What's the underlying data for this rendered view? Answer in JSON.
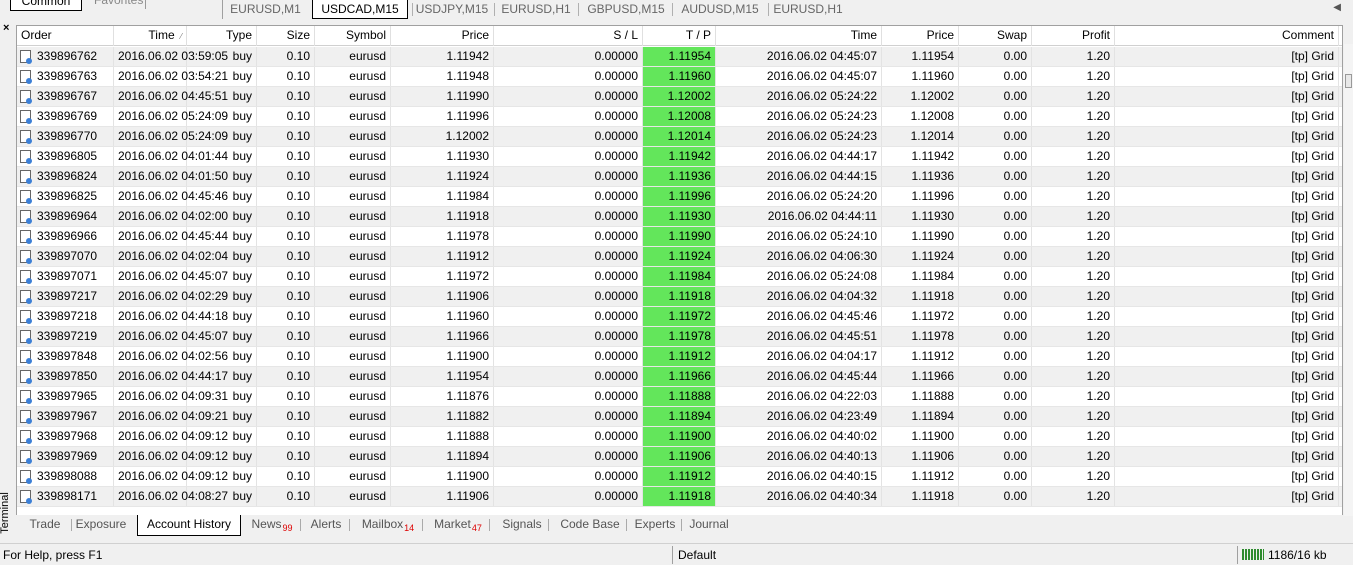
{
  "nav_tabs": {
    "common": "Common",
    "favorites": "Favorites"
  },
  "chart_tabs": [
    "EURUSD,M1",
    "USDCAD,M15",
    "USDJPY,M15",
    "EURUSD,H1",
    "GBPUSD,M15",
    "AUDUSD,M15",
    "EURUSD,H1"
  ],
  "chart_tabs_active": "USDCAD,M15",
  "terminal_label": "Terminal",
  "columns": [
    "Order",
    "Time",
    "Type",
    "Size",
    "Symbol",
    "Price",
    "S / L",
    "T / P",
    "Time",
    "Price",
    "Swap",
    "Profit",
    "Comment"
  ],
  "rows": [
    [
      "339896762",
      "2016.06.02 03:59:05",
      "buy",
      "0.10",
      "eurusd",
      "1.11942",
      "0.00000",
      "1.11954",
      "2016.06.02 04:45:07",
      "1.11954",
      "0.00",
      "1.20",
      "[tp]  Grid"
    ],
    [
      "339896763",
      "2016.06.02 03:54:21",
      "buy",
      "0.10",
      "eurusd",
      "1.11948",
      "0.00000",
      "1.11960",
      "2016.06.02 04:45:07",
      "1.11960",
      "0.00",
      "1.20",
      "[tp]  Grid"
    ],
    [
      "339896767",
      "2016.06.02 04:45:51",
      "buy",
      "0.10",
      "eurusd",
      "1.11990",
      "0.00000",
      "1.12002",
      "2016.06.02 05:24:22",
      "1.12002",
      "0.00",
      "1.20",
      "[tp]  Grid"
    ],
    [
      "339896769",
      "2016.06.02 05:24:09",
      "buy",
      "0.10",
      "eurusd",
      "1.11996",
      "0.00000",
      "1.12008",
      "2016.06.02 05:24:23",
      "1.12008",
      "0.00",
      "1.20",
      "[tp]  Grid"
    ],
    [
      "339896770",
      "2016.06.02 05:24:09",
      "buy",
      "0.10",
      "eurusd",
      "1.12002",
      "0.00000",
      "1.12014",
      "2016.06.02 05:24:23",
      "1.12014",
      "0.00",
      "1.20",
      "[tp]  Grid"
    ],
    [
      "339896805",
      "2016.06.02 04:01:44",
      "buy",
      "0.10",
      "eurusd",
      "1.11930",
      "0.00000",
      "1.11942",
      "2016.06.02 04:44:17",
      "1.11942",
      "0.00",
      "1.20",
      "[tp]  Grid"
    ],
    [
      "339896824",
      "2016.06.02 04:01:50",
      "buy",
      "0.10",
      "eurusd",
      "1.11924",
      "0.00000",
      "1.11936",
      "2016.06.02 04:44:15",
      "1.11936",
      "0.00",
      "1.20",
      "[tp]  Grid"
    ],
    [
      "339896825",
      "2016.06.02 04:45:46",
      "buy",
      "0.10",
      "eurusd",
      "1.11984",
      "0.00000",
      "1.11996",
      "2016.06.02 05:24:20",
      "1.11996",
      "0.00",
      "1.20",
      "[tp]  Grid"
    ],
    [
      "339896964",
      "2016.06.02 04:02:00",
      "buy",
      "0.10",
      "eurusd",
      "1.11918",
      "0.00000",
      "1.11930",
      "2016.06.02 04:44:11",
      "1.11930",
      "0.00",
      "1.20",
      "[tp]  Grid"
    ],
    [
      "339896966",
      "2016.06.02 04:45:44",
      "buy",
      "0.10",
      "eurusd",
      "1.11978",
      "0.00000",
      "1.11990",
      "2016.06.02 05:24:10",
      "1.11990",
      "0.00",
      "1.20",
      "[tp]  Grid"
    ],
    [
      "339897070",
      "2016.06.02 04:02:04",
      "buy",
      "0.10",
      "eurusd",
      "1.11912",
      "0.00000",
      "1.11924",
      "2016.06.02 04:06:30",
      "1.11924",
      "0.00",
      "1.20",
      "[tp]  Grid"
    ],
    [
      "339897071",
      "2016.06.02 04:45:07",
      "buy",
      "0.10",
      "eurusd",
      "1.11972",
      "0.00000",
      "1.11984",
      "2016.06.02 05:24:08",
      "1.11984",
      "0.00",
      "1.20",
      "[tp]  Grid"
    ],
    [
      "339897217",
      "2016.06.02 04:02:29",
      "buy",
      "0.10",
      "eurusd",
      "1.11906",
      "0.00000",
      "1.11918",
      "2016.06.02 04:04:32",
      "1.11918",
      "0.00",
      "1.20",
      "[tp]  Grid"
    ],
    [
      "339897218",
      "2016.06.02 04:44:18",
      "buy",
      "0.10",
      "eurusd",
      "1.11960",
      "0.00000",
      "1.11972",
      "2016.06.02 04:45:46",
      "1.11972",
      "0.00",
      "1.20",
      "[tp]  Grid"
    ],
    [
      "339897219",
      "2016.06.02 04:45:07",
      "buy",
      "0.10",
      "eurusd",
      "1.11966",
      "0.00000",
      "1.11978",
      "2016.06.02 04:45:51",
      "1.11978",
      "0.00",
      "1.20",
      "[tp]  Grid"
    ],
    [
      "339897848",
      "2016.06.02 04:02:56",
      "buy",
      "0.10",
      "eurusd",
      "1.11900",
      "0.00000",
      "1.11912",
      "2016.06.02 04:04:17",
      "1.11912",
      "0.00",
      "1.20",
      "[tp]  Grid"
    ],
    [
      "339897850",
      "2016.06.02 04:44:17",
      "buy",
      "0.10",
      "eurusd",
      "1.11954",
      "0.00000",
      "1.11966",
      "2016.06.02 04:45:44",
      "1.11966",
      "0.00",
      "1.20",
      "[tp]  Grid"
    ],
    [
      "339897965",
      "2016.06.02 04:09:31",
      "buy",
      "0.10",
      "eurusd",
      "1.11876",
      "0.00000",
      "1.11888",
      "2016.06.02 04:22:03",
      "1.11888",
      "0.00",
      "1.20",
      "[tp]  Grid"
    ],
    [
      "339897967",
      "2016.06.02 04:09:21",
      "buy",
      "0.10",
      "eurusd",
      "1.11882",
      "0.00000",
      "1.11894",
      "2016.06.02 04:23:49",
      "1.11894",
      "0.00",
      "1.20",
      "[tp]  Grid"
    ],
    [
      "339897968",
      "2016.06.02 04:09:12",
      "buy",
      "0.10",
      "eurusd",
      "1.11888",
      "0.00000",
      "1.11900",
      "2016.06.02 04:40:02",
      "1.11900",
      "0.00",
      "1.20",
      "[tp]  Grid"
    ],
    [
      "339897969",
      "2016.06.02 04:09:12",
      "buy",
      "0.10",
      "eurusd",
      "1.11894",
      "0.00000",
      "1.11906",
      "2016.06.02 04:40:13",
      "1.11906",
      "0.00",
      "1.20",
      "[tp]  Grid"
    ],
    [
      "339898088",
      "2016.06.02 04:09:12",
      "buy",
      "0.10",
      "eurusd",
      "1.11900",
      "0.00000",
      "1.11912",
      "2016.06.02 04:40:15",
      "1.11912",
      "0.00",
      "1.20",
      "[tp]  Grid"
    ],
    [
      "339898171",
      "2016.06.02 04:08:27",
      "buy",
      "0.10",
      "eurusd",
      "1.11906",
      "0.00000",
      "1.11918",
      "2016.06.02 04:40:34",
      "1.11918",
      "0.00",
      "1.20",
      "[tp]  Grid"
    ]
  ],
  "bottom_tabs": [
    {
      "label": "Trade",
      "count": ""
    },
    {
      "label": "Exposure",
      "count": ""
    },
    {
      "label": "Account History",
      "count": ""
    },
    {
      "label": "News",
      "count": "99"
    },
    {
      "label": "Alerts",
      "count": ""
    },
    {
      "label": "Mailbox",
      "count": "14"
    },
    {
      "label": "Market",
      "count": "47"
    },
    {
      "label": "Signals",
      "count": ""
    },
    {
      "label": "Code Base",
      "count": ""
    },
    {
      "label": "Experts",
      "count": ""
    },
    {
      "label": "Journal",
      "count": ""
    }
  ],
  "bottom_tabs_active": "Account History",
  "status": {
    "help": "For Help, press F1",
    "profile": "Default",
    "traffic": "1186/16 kb"
  },
  "colors": {
    "tp_highlight": "#63e65b",
    "row_alt": "#f0f0f0",
    "news_count": "#dd0000"
  }
}
